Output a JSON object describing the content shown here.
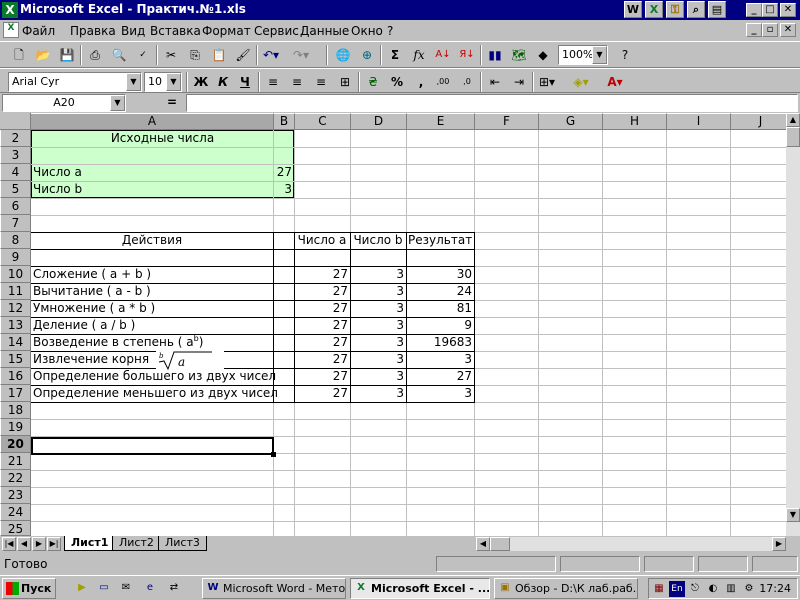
{
  "window": {
    "title": "Microsoft Excel - Практич.№1.xls",
    "app_icon": "excel-icon",
    "title_icons": [
      "excel-icon",
      "word-icon",
      "excel-icon",
      "keys-icon",
      "search-icon",
      "app-icon"
    ],
    "controls": {
      "minimize": "_",
      "maximize": "□",
      "close": "✕",
      "restore": "▫"
    }
  },
  "menu": {
    "items": [
      "Файл",
      "Правка",
      "Вид",
      "Вставка",
      "Формат",
      "Сервис",
      "Данные",
      "Окно",
      "?"
    ]
  },
  "toolbar_standard": {
    "zoom": "100%",
    "icons": [
      "new-icon",
      "open-icon",
      "save-icon",
      "print-icon",
      "print-preview-icon",
      "spelling-icon",
      "cut-icon",
      "copy-icon",
      "paste-icon",
      "format-painter-icon",
      "undo-icon",
      "redo-icon",
      "hyperlink-icon",
      "web-icon",
      "autosum-icon",
      "function-icon",
      "sort-asc-icon",
      "sort-desc-icon",
      "chart-wizard-icon",
      "map-icon",
      "drawing-icon",
      "help-icon"
    ],
    "autosum_glyph": "Σ",
    "function_glyph": "fx"
  },
  "toolbar_format": {
    "font": "Arial Cyr",
    "size": "10",
    "bold": "Ж",
    "italic": "К",
    "underline": "Ч",
    "percent": "%",
    "comma": ",",
    "increase_decimal": ",00",
    "decrease_decimal": ",0"
  },
  "formula_bar": {
    "name_box": "A20",
    "equals": "=",
    "content": ""
  },
  "columns": [
    "A",
    "B",
    "C",
    "D",
    "E",
    "F",
    "G",
    "H",
    "I",
    "J"
  ],
  "rows": [
    "2",
    "3",
    "4",
    "5",
    "6",
    "7",
    "8",
    "9",
    "10",
    "11",
    "12",
    "13",
    "14",
    "15",
    "16",
    "17",
    "18",
    "19",
    "20",
    "21",
    "22",
    "23",
    "24",
    "25"
  ],
  "sheet": {
    "source_title": "Исходные числа",
    "a_label": "Число a",
    "a_value": "27",
    "b_label": "Число b",
    "b_value": "3",
    "headers": {
      "action": "Действия",
      "num_a": "Число а",
      "num_b": "Число b",
      "result": "Результат"
    },
    "operations": [
      {
        "label": "Сложение   ( a + b )",
        "a": "27",
        "b": "3",
        "result": "30"
      },
      {
        "label": "Вычитание  ( a - b )",
        "a": "27",
        "b": "3",
        "result": "24"
      },
      {
        "label": "Умножение  ( a * b )",
        "a": "27",
        "b": "3",
        "result": "81"
      },
      {
        "label": "Деление     ( a / b )",
        "a": "27",
        "b": "3",
        "result": "9"
      },
      {
        "label": "Возведение в степень ( a",
        "a": "27",
        "b": "3",
        "result": "19683"
      },
      {
        "label": "Извлечение корня",
        "a": "27",
        "b": "3",
        "result": "3"
      },
      {
        "label": "Определение большего из двух чисел",
        "a": "27",
        "b": "3",
        "result": "27"
      },
      {
        "label": "Определение меньшего из двух чисел",
        "a": "27",
        "b": "3",
        "result": "3"
      }
    ],
    "power_sup": "b",
    "power_close": ")",
    "root_index": "b",
    "root_radicand": "a"
  },
  "tabs": [
    "Лист1",
    "Лист2",
    "Лист3"
  ],
  "status": {
    "text": "Готово"
  },
  "taskbar": {
    "start": "Пуск",
    "tasks": [
      "Microsoft Word - Мето...",
      "Microsoft Excel - ...",
      "Обзор - D:\\К лаб.раб..."
    ],
    "lang": "En",
    "clock": "17:24"
  }
}
